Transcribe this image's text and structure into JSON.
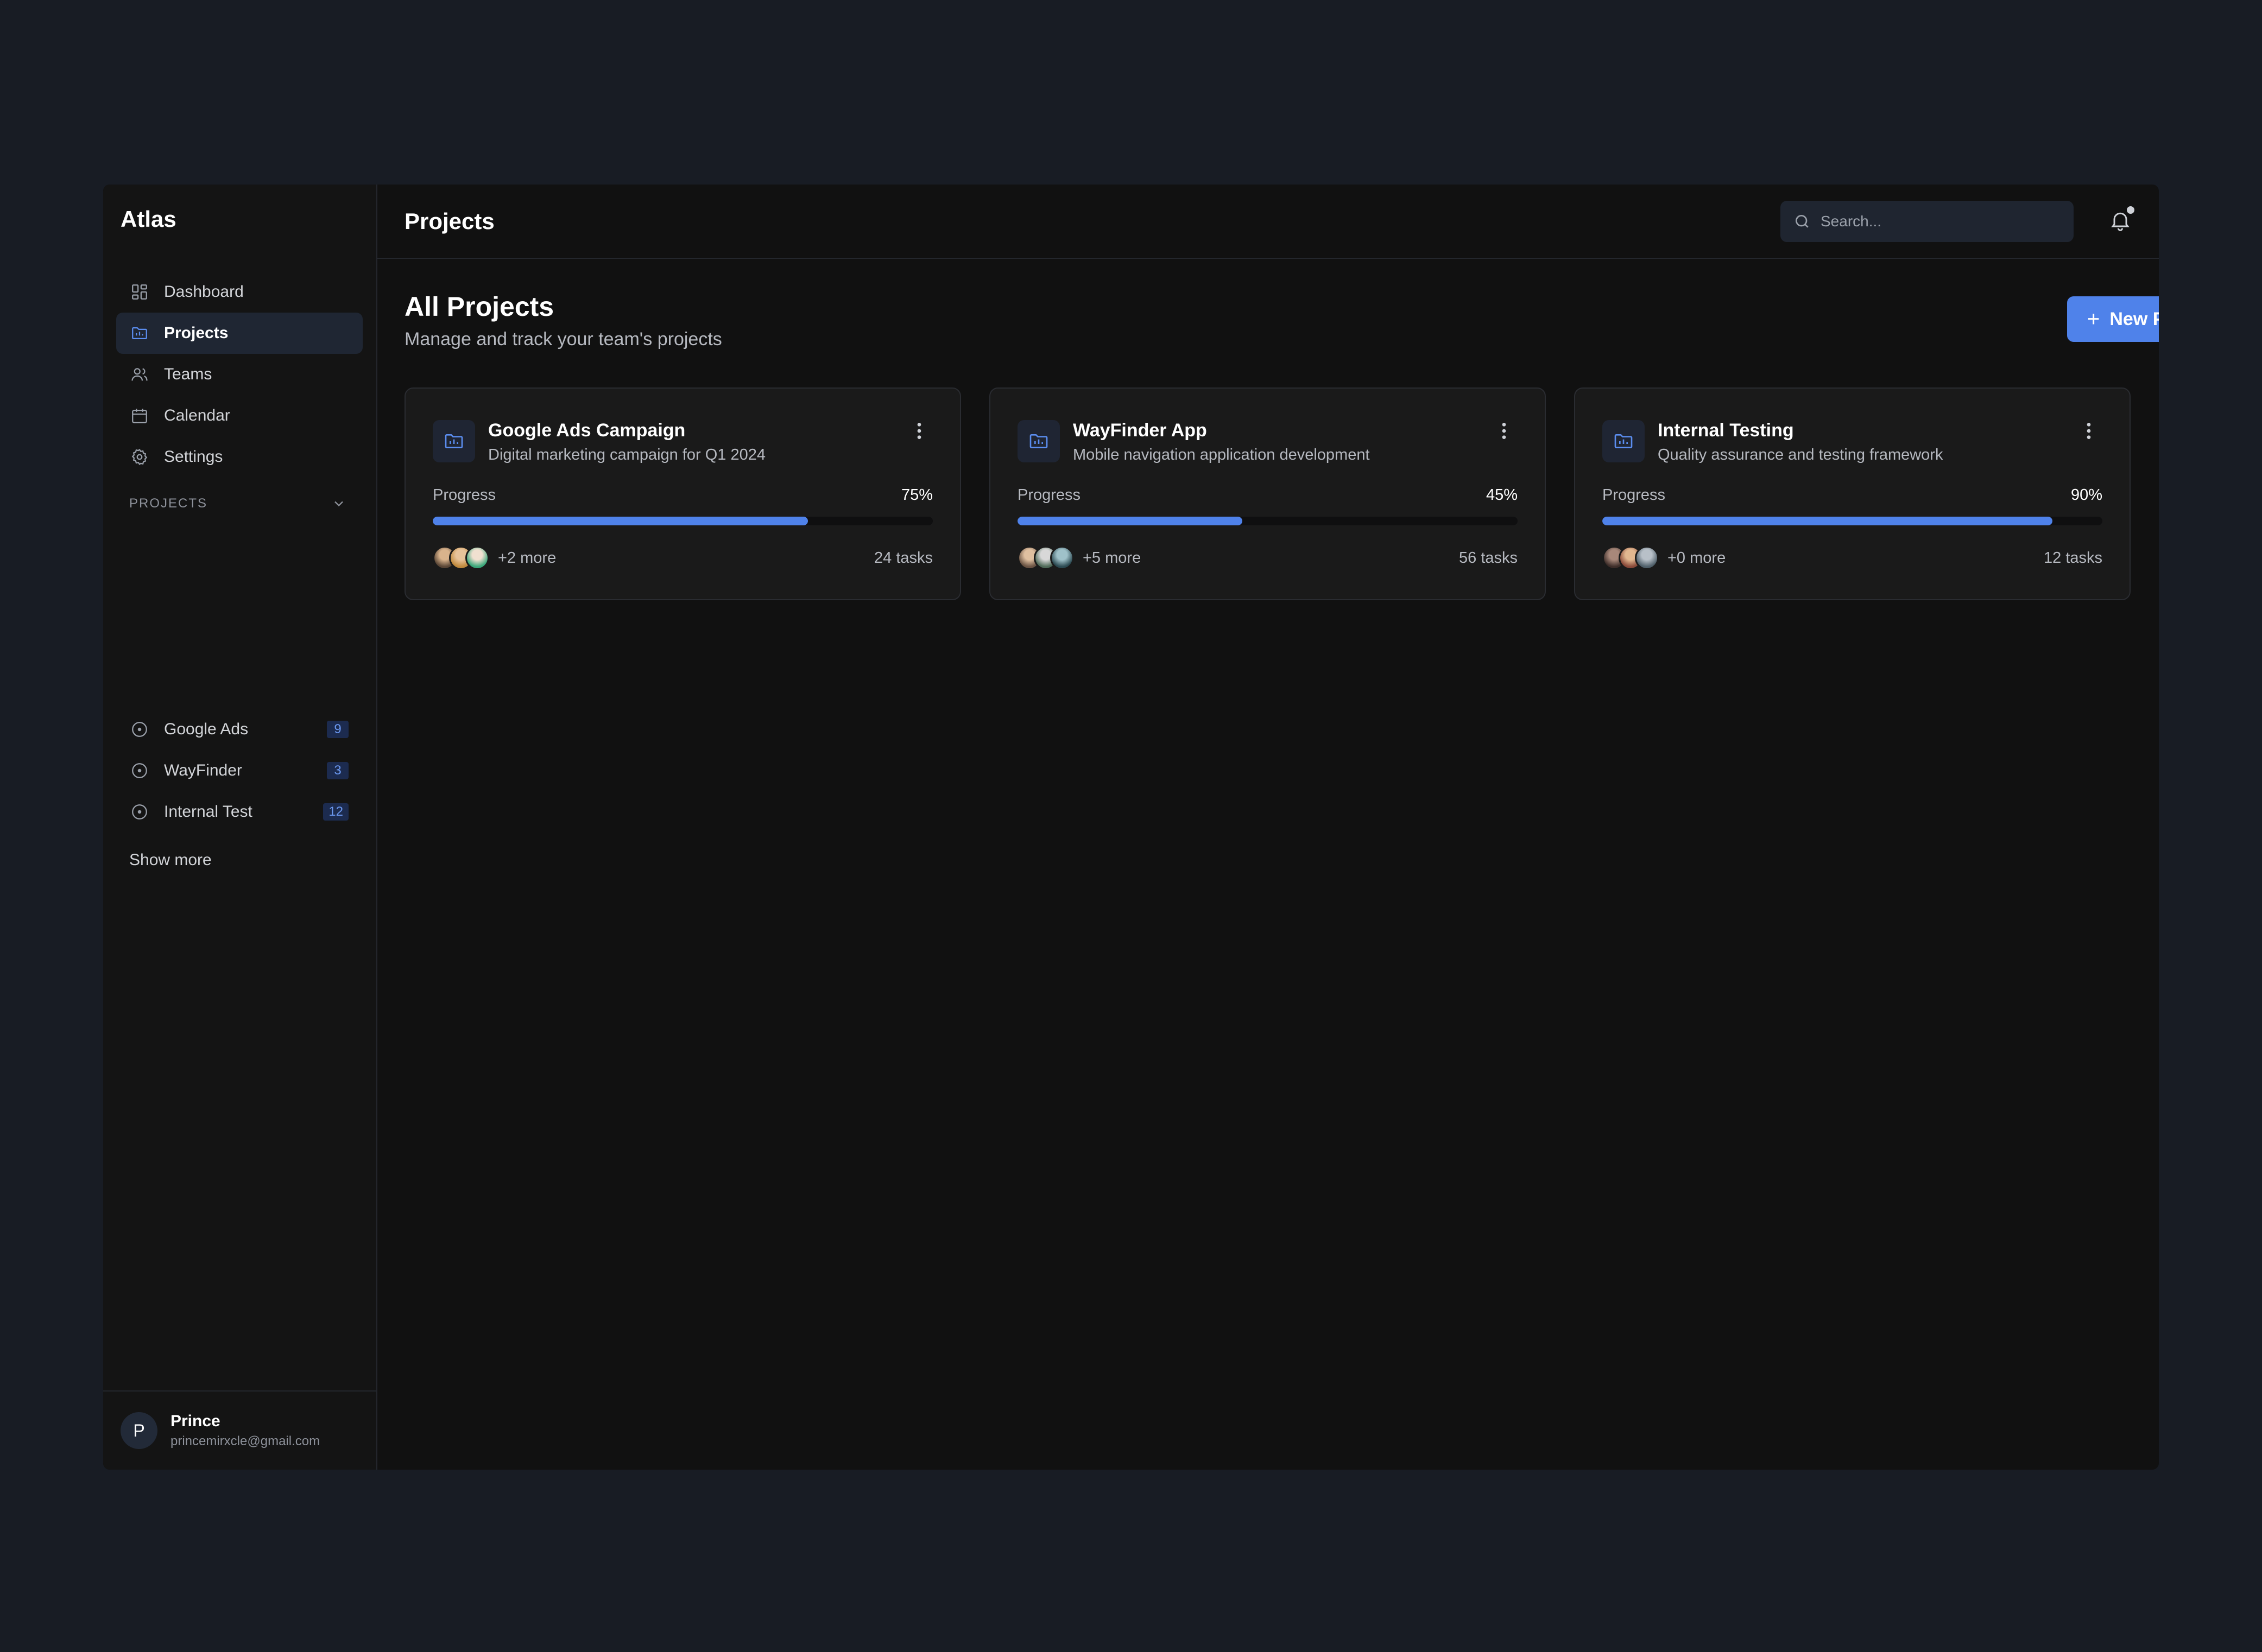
{
  "app": {
    "brand": "Atlas"
  },
  "sidebar": {
    "nav": [
      {
        "label": "Dashboard",
        "icon": "dashboard-icon"
      },
      {
        "label": "Projects",
        "icon": "folder-icon",
        "active": true
      },
      {
        "label": "Teams",
        "icon": "users-icon"
      },
      {
        "label": "Calendar",
        "icon": "calendar-icon"
      },
      {
        "label": "Settings",
        "icon": "gear-icon"
      }
    ],
    "section_title": "PROJECTS",
    "projects": [
      {
        "label": "Google Ads",
        "count": "9"
      },
      {
        "label": "WayFinder",
        "count": "3"
      },
      {
        "label": "Internal Test",
        "count": "12"
      }
    ],
    "show_more": "Show more",
    "user": {
      "initial": "P",
      "name": "Prince",
      "email": "princemirxcle@gmail.com"
    }
  },
  "header": {
    "title": "Projects",
    "search_placeholder": "Search..."
  },
  "main": {
    "title": "All Projects",
    "subtitle": "Manage and track your team's projects",
    "new_button": "New Project",
    "progress_label": "Progress",
    "cards": [
      {
        "title": "Google Ads Campaign",
        "description": "Digital marketing campaign for Q1 2024",
        "progress_text": "75%",
        "progress": 0.75,
        "more": "+2 more",
        "tasks": "24 tasks"
      },
      {
        "title": "WayFinder App",
        "description": "Mobile navigation application development",
        "progress_text": "45%",
        "progress": 0.45,
        "more": "+5 more",
        "tasks": "56 tasks"
      },
      {
        "title": "Internal Testing",
        "description": "Quality assurance and testing framework",
        "progress_text": "90%",
        "progress": 0.9,
        "more": "+0 more",
        "tasks": "12 tasks"
      }
    ]
  },
  "colors": {
    "accent": "#4f82ea",
    "background": "#181c24",
    "panel": "#111111"
  }
}
